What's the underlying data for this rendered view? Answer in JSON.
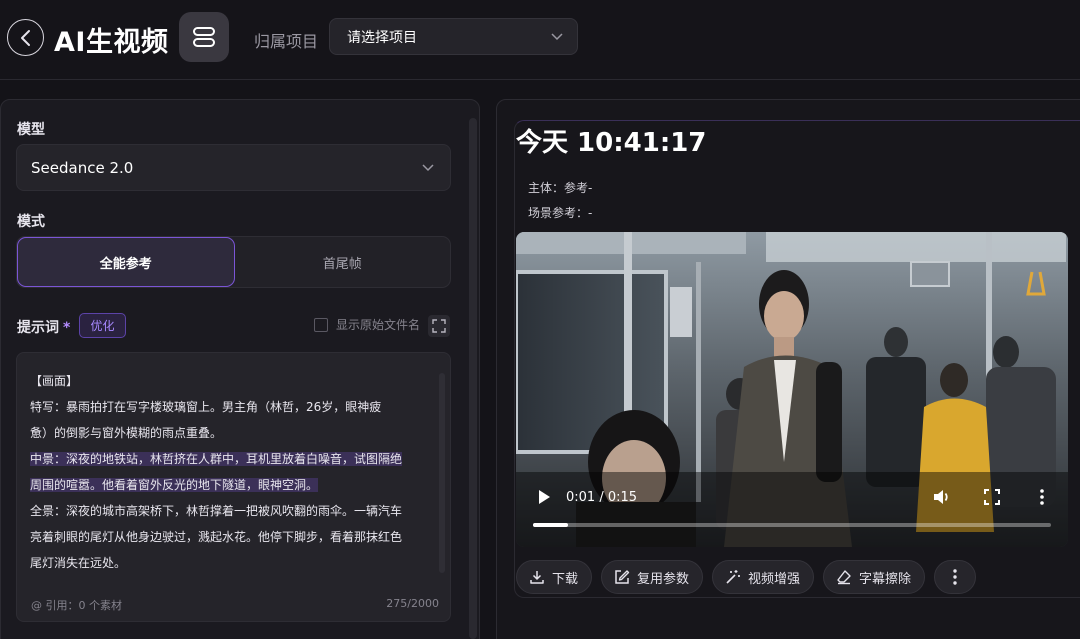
{
  "header": {
    "title": "AI生视频",
    "project_label": "归属项目",
    "project_select": "请选择项目"
  },
  "left": {
    "model_label": "模型",
    "model_value": "Seedance 2.0",
    "mode_label": "模式",
    "modes": [
      {
        "label": "全能参考",
        "active": true
      },
      {
        "label": "首尾帧",
        "active": false
      }
    ],
    "prompt_label": "提示词",
    "required_mark": "*",
    "optimize_label": "优化",
    "show_filename_label": "显示原始文件名",
    "prompt_lines": [
      "【画面】",
      "特写：暴雨拍打在写字楼玻璃窗上。男主角（林哲，26岁，眼神疲",
      "惫）的倒影与窗外模糊的雨点重叠。",
      "中景：深夜的地铁站，林哲挤在人群中，耳机里放着白噪音，试图隔绝",
      "周围的喧嚣。他看着窗外反光的地下隧道，眼神空洞。",
      "全景：深夜的城市高架桥下，林哲撑着一把被风吹翻的雨伞。一辆汽车",
      "亮着刺眼的尾灯从他身边驶过，溅起水花。他停下脚步，看着那抹红色",
      "尾灯消失在远处。"
    ],
    "reference_text": "@ 引用：0 个素材",
    "char_count": "275/2000"
  },
  "right": {
    "time_title": "今天 10:41:17",
    "subject_line": "主体：参考-",
    "scene_line": "场景参考：-",
    "video": {
      "time_display": "0:01 / 0:15",
      "progress": 0.0667
    },
    "actions": [
      {
        "label": "下载",
        "icon": "download-icon"
      },
      {
        "label": "复用参数",
        "icon": "edit-icon"
      },
      {
        "label": "视频增强",
        "icon": "magic-wand-icon"
      },
      {
        "label": "字幕擦除",
        "icon": "eraser-icon"
      }
    ]
  },
  "colors": {
    "accent": "#7b55d6",
    "accent_text": "#a889ff",
    "background": "#141318"
  }
}
